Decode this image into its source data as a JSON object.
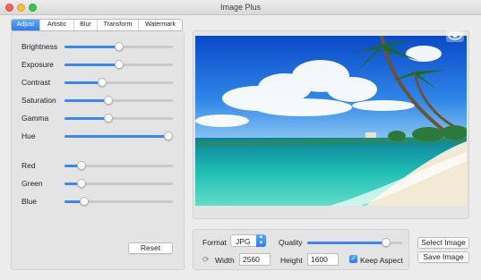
{
  "window": {
    "title": "Image Plus"
  },
  "tabs": [
    {
      "label": "Adjust",
      "active": true
    },
    {
      "label": "Artistic",
      "active": false
    },
    {
      "label": "Blur",
      "active": false
    },
    {
      "label": "Transform",
      "active": false
    },
    {
      "label": "Watermark",
      "active": false
    }
  ],
  "adjust": {
    "sliders": [
      {
        "label": "Brightness",
        "value": 0.5
      },
      {
        "label": "Exposure",
        "value": 0.5
      },
      {
        "label": "Contrast",
        "value": 0.33
      },
      {
        "label": "Saturation",
        "value": 0.4
      },
      {
        "label": "Gamma",
        "value": 0.4
      },
      {
        "label": "Hue",
        "value": 1.0
      },
      {
        "label": "Red",
        "value": 0.13
      },
      {
        "label": "Green",
        "value": 0.13
      },
      {
        "label": "Blue",
        "value": 0.15
      }
    ],
    "reset_label": "Reset"
  },
  "preview": {
    "eye_icon": "eye-icon"
  },
  "export": {
    "format_label": "Format",
    "format_value": "JPG",
    "quality_label": "Quality",
    "quality_value": 0.86,
    "width_label": "Width",
    "width_value": "2560",
    "height_label": "Height",
    "height_value": "1600",
    "keep_aspect_label": "Keep Aspect",
    "keep_aspect_checked": true
  },
  "actions": {
    "select_image_label": "Select Image",
    "save_image_label": "Save Image"
  },
  "colors": {
    "accent": "#3b86f6",
    "window_bg": "#ececec"
  }
}
